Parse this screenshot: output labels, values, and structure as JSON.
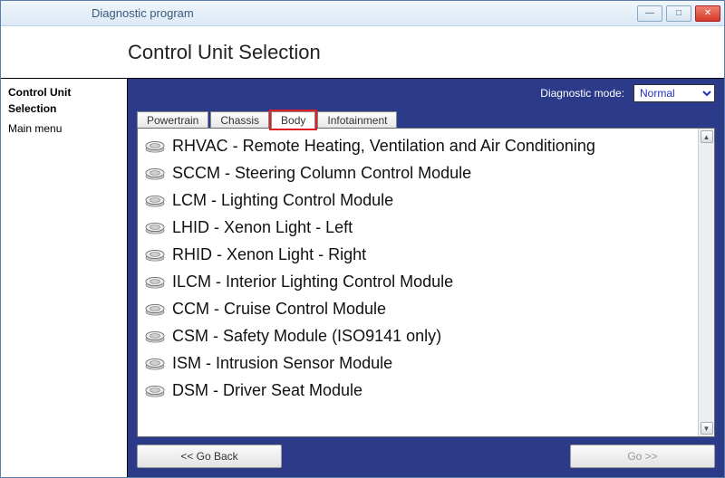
{
  "window": {
    "title": "Diagnostic program"
  },
  "header": {
    "title": "Control Unit Selection"
  },
  "sidebar": {
    "items": [
      {
        "label": "Control Unit Selection",
        "active": true
      },
      {
        "label": "Main menu",
        "active": false
      }
    ]
  },
  "diagnostic": {
    "label": "Diagnostic mode:",
    "selected": "Normal"
  },
  "tabs": [
    {
      "label": "Powertrain",
      "active": false
    },
    {
      "label": "Chassis",
      "active": false
    },
    {
      "label": "Body",
      "active": true
    },
    {
      "label": "Infotainment",
      "active": false
    }
  ],
  "modules": [
    "RHVAC - Remote Heating, Ventilation and Air Conditioning",
    "SCCM - Steering Column Control Module",
    "LCM - Lighting Control Module",
    "LHID - Xenon Light - Left",
    "RHID - Xenon Light - Right",
    "ILCM - Interior Lighting Control Module",
    "CCM - Cruise Control Module",
    "CSM - Safety Module (ISO9141 only)",
    "ISM - Intrusion Sensor Module",
    "DSM - Driver Seat Module"
  ],
  "buttons": {
    "back": "<< Go Back",
    "go": "Go >>"
  }
}
